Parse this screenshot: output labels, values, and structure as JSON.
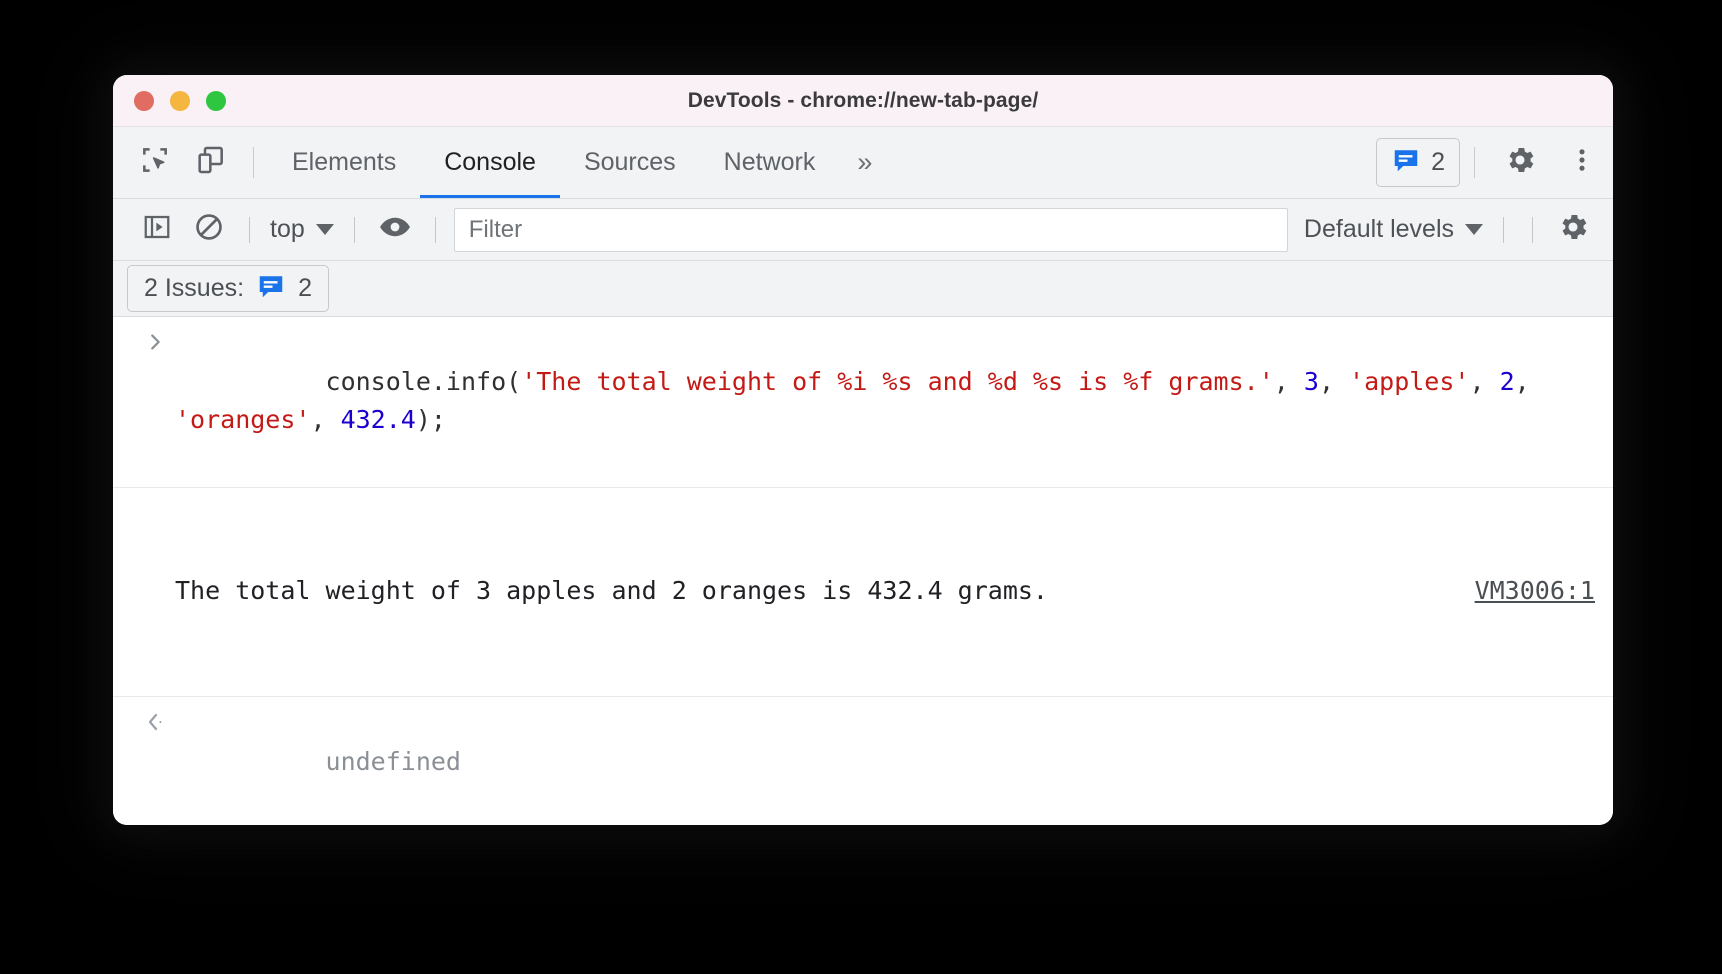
{
  "window": {
    "title": "DevTools - chrome://new-tab-page/",
    "traffic_lights": [
      "close",
      "minimize",
      "maximize"
    ],
    "colors": {
      "titlebar_bg": "#f9f1f5",
      "toolbar_bg": "#f1f3f4",
      "accent_blue": "#1a73e8",
      "string_red": "#c41a16",
      "number_blue": "#1c00cf",
      "link_gray": "#4a4f54"
    }
  },
  "tabbar": {
    "icons": [
      {
        "name": "inspect-element-icon",
        "label": "Inspect element"
      },
      {
        "name": "device-toolbar-icon",
        "label": "Toggle device toolbar"
      }
    ],
    "tabs": [
      {
        "label": "Elements",
        "active": false
      },
      {
        "label": "Console",
        "active": true
      },
      {
        "label": "Sources",
        "active": false
      },
      {
        "label": "Network",
        "active": false
      }
    ],
    "more_tabs": "»",
    "issues_chip": {
      "icon": "message-icon",
      "count": "2"
    },
    "settings_icon": "gear-icon",
    "menu_icon": "more-vertical-icon"
  },
  "console_toolbar": {
    "sidebar_toggle_icon": "sidebar-toggle-icon",
    "clear_console_icon": "clear-console-icon",
    "context_selector": "top",
    "eye_icon": "live-expression-eye-icon",
    "filter": {
      "value": "",
      "placeholder": "Filter"
    },
    "levels_selector": "Default levels",
    "settings_icon": "gear-icon"
  },
  "issues_bar": {
    "label": "2 Issues:",
    "icon": "message-icon",
    "count": "2"
  },
  "console": {
    "input_prompt_glyph": "›",
    "output_prompt_glyph": "‹",
    "entries": [
      {
        "type": "input",
        "tokens": [
          {
            "text": "console.info(",
            "kind": "plain"
          },
          {
            "text": "'The total weight of %i %s and %d %s is %f grams.'",
            "kind": "string"
          },
          {
            "text": ", ",
            "kind": "plain"
          },
          {
            "text": "3",
            "kind": "number"
          },
          {
            "text": ", ",
            "kind": "plain"
          },
          {
            "text": "'apples'",
            "kind": "string"
          },
          {
            "text": ", ",
            "kind": "plain"
          },
          {
            "text": "2",
            "kind": "number"
          },
          {
            "text": ", ",
            "kind": "plain"
          },
          {
            "text": "'oranges'",
            "kind": "string"
          },
          {
            "text": ", ",
            "kind": "plain"
          },
          {
            "text": "432.4",
            "kind": "number"
          },
          {
            "text": ");",
            "kind": "plain"
          }
        ]
      },
      {
        "type": "output",
        "text": "The total weight of 3 apples and 2 oranges is 432.4 grams.",
        "source_link": "VM3006:1"
      },
      {
        "type": "result",
        "text": "undefined"
      },
      {
        "type": "prompt"
      }
    ]
  }
}
